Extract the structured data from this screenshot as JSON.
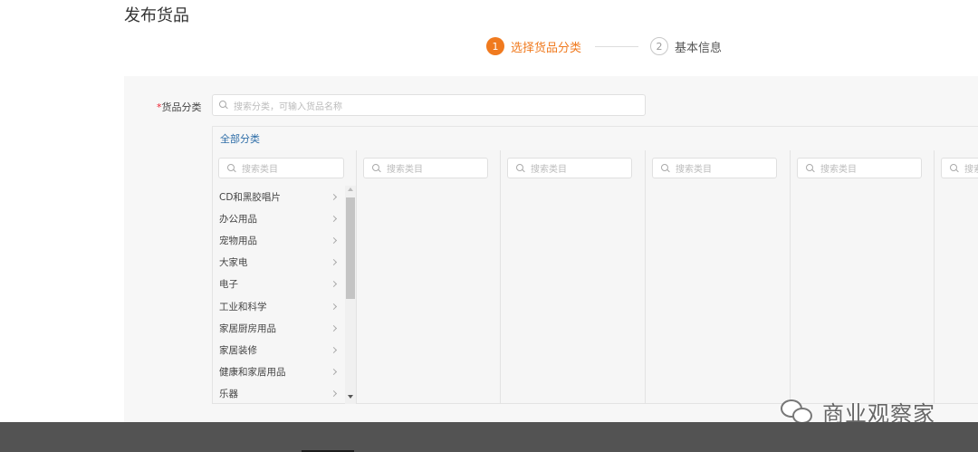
{
  "page": {
    "title": "发布货品"
  },
  "steps": [
    {
      "number": "1",
      "label": "选择货品分类",
      "status": "active"
    },
    {
      "number": "2",
      "label": "基本信息",
      "status": "inactive"
    }
  ],
  "form": {
    "category_label": "货品分类",
    "required_mark": "*",
    "search_placeholder": "搜索分类，可输入货品名称"
  },
  "category_browser": {
    "header": "全部分类",
    "column_search_placeholder": "搜索类目",
    "first_column_items": [
      "CD和黑胶唱片",
      "办公用品",
      "宠物用品",
      "大家电",
      "电子",
      "工业和科学",
      "家居厨房用品",
      "家居装修",
      "健康和家居用品",
      "乐器"
    ],
    "extra_column_placeholder": "搜索"
  },
  "watermark": {
    "text": "商业观察家",
    "icon": "wechat-icon"
  },
  "colors": {
    "accent": "#f07a1f",
    "link": "#2f6ea8",
    "bottom_bar": "#535353"
  }
}
